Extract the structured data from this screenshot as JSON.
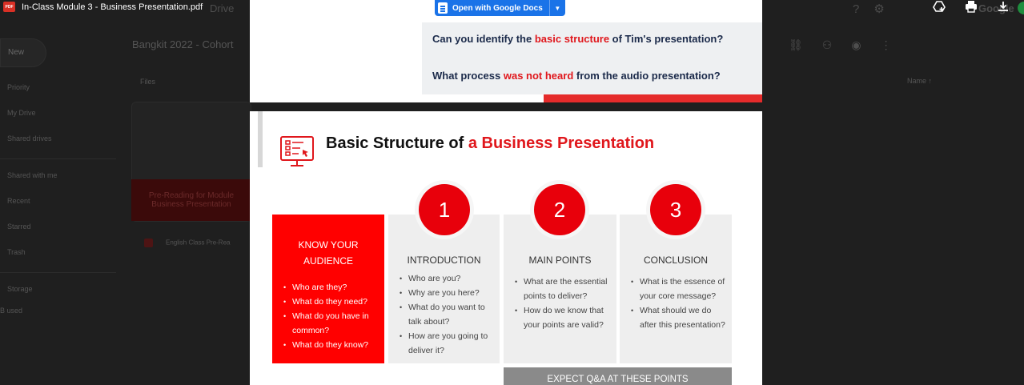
{
  "viewer": {
    "file_title": "In-Class Module 3 - Business Presentation.pdf",
    "pdf_badge": "PDF",
    "open_with_label": "Open with Google Docs",
    "actions": {
      "add_to_drive": "add-to-drive-icon",
      "print": "print-icon",
      "download": "download-icon"
    }
  },
  "background_drive": {
    "app_word": "Drive",
    "google_word": "Google",
    "new_label": "New",
    "nav": [
      "Priority",
      "My Drive",
      "Shared drives",
      "Shared with me",
      "Recent",
      "Starred",
      "Trash",
      "Storage"
    ],
    "storage_used": "B used",
    "breadcrumb": "Bangkit 2022 - Cohort",
    "files_label": "Files",
    "sort_label": "Name",
    "card_title_line1": "Pre-Reading for Module",
    "card_title_line2": "Business Presentation",
    "file_row": "English Class Pre-Rea"
  },
  "page1": {
    "q1_pre": "Can you identify the ",
    "q1_hl": "basic structure",
    "q1_post": " of Tim's presentation?",
    "q2_pre": "What process ",
    "q2_hl": "was not heard",
    "q2_post": " from the audio presentation?"
  },
  "page2": {
    "heading_pre": "Basic Structure of ",
    "heading_hl": "a Business Presentation",
    "audience": {
      "title_line1": "KNOW YOUR",
      "title_line2": "AUDIENCE",
      "bullets": [
        "Who are they?",
        "What do they need?",
        "What do you have in common?",
        "What do they know?"
      ]
    },
    "columns": [
      {
        "number": "1",
        "title": "INTRODUCTION",
        "bullets": [
          "Who are you?",
          "Why are you here?",
          "What do you want to talk about?",
          "How are you going to deliver it?"
        ]
      },
      {
        "number": "2",
        "title": "MAIN POINTS",
        "bullets": [
          "What are the essential points to deliver?",
          "How do we know that your points  are valid?"
        ]
      },
      {
        "number": "3",
        "title": "CONCLUSION",
        "bullets": [
          "What is the essence of your core message?",
          "What should we  do after this presentation?"
        ]
      }
    ],
    "expect": "EXPECT Q&A AT THESE POINTS"
  },
  "colors": {
    "accent_red": "#e0171c",
    "docs_blue": "#1a73e8",
    "navy_text": "#1b2a4a"
  }
}
